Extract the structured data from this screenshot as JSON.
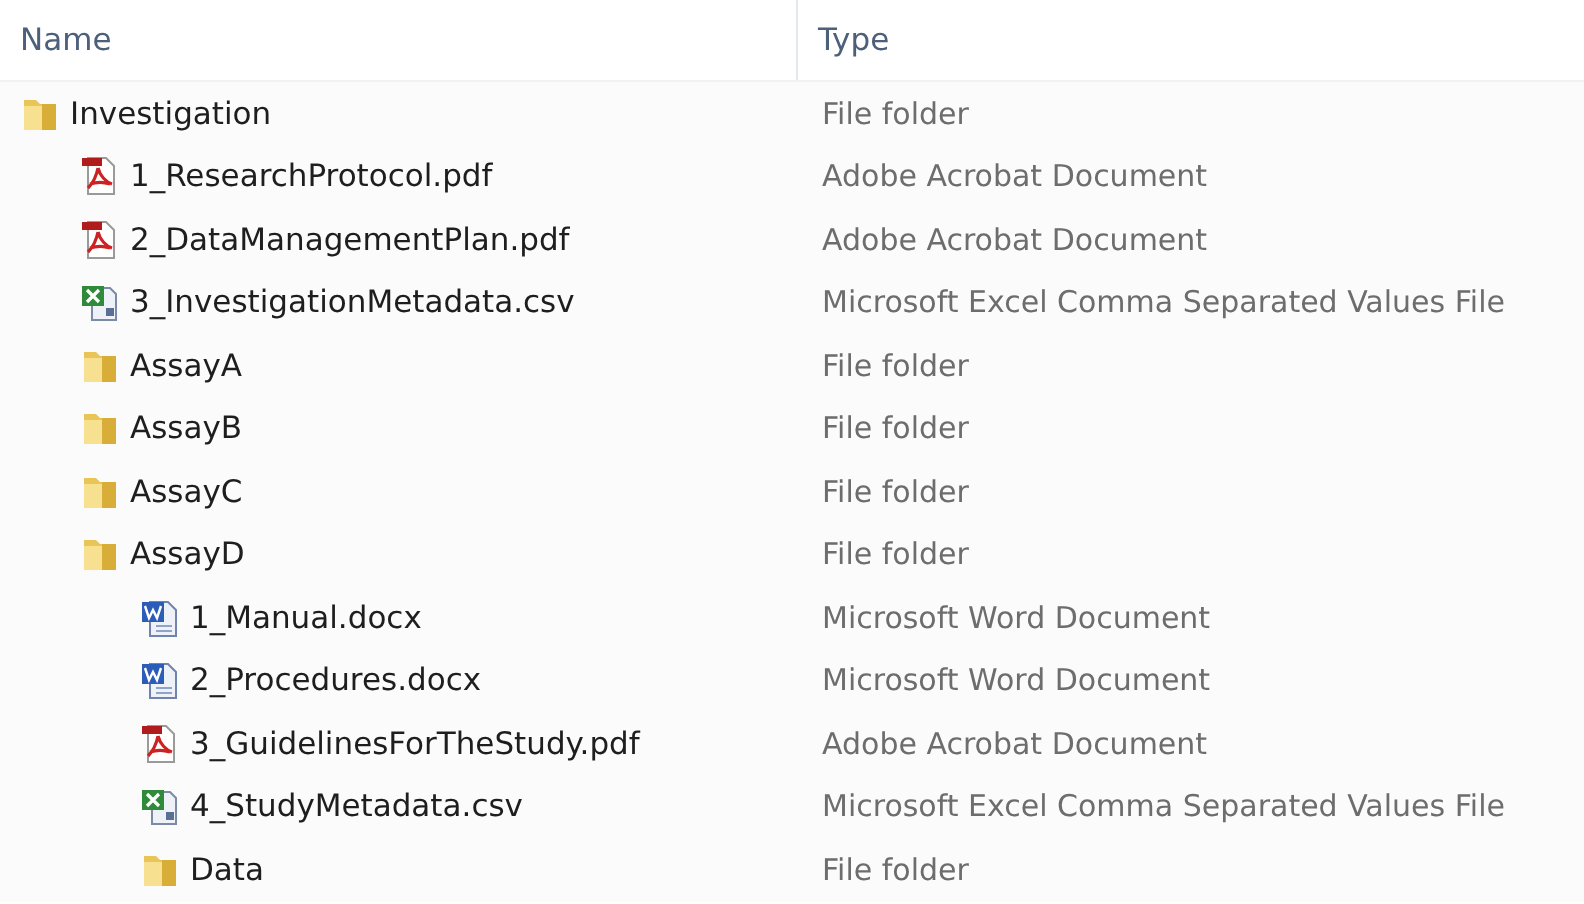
{
  "columns": [
    "Name",
    "Type"
  ],
  "items": [
    {
      "name": "Investigation",
      "kind": "folder",
      "type": "File folder",
      "children": [
        {
          "name": "1_ResearchProtocol.pdf",
          "kind": "pdf",
          "type": "Adobe Acrobat Document"
        },
        {
          "name": "2_DataManagementPlan.pdf",
          "kind": "pdf",
          "type": "Adobe Acrobat Document"
        },
        {
          "name": "3_InvestigationMetadata.csv",
          "kind": "excel",
          "type": "Microsoft Excel Comma Separated Values File"
        },
        {
          "name": "AssayA",
          "kind": "folder",
          "type": "File folder"
        },
        {
          "name": "AssayB",
          "kind": "folder",
          "type": "File folder"
        },
        {
          "name": "AssayC",
          "kind": "folder",
          "type": "File folder"
        },
        {
          "name": "AssayD",
          "kind": "folder",
          "type": "File folder",
          "children": [
            {
              "name": "1_Manual.docx",
              "kind": "word",
              "type": "Microsoft Word Document"
            },
            {
              "name": "2_Procedures.docx",
              "kind": "word",
              "type": "Microsoft Word Document"
            },
            {
              "name": "3_GuidelinesForTheStudy.pdf",
              "kind": "pdf",
              "type": "Adobe Acrobat Document"
            },
            {
              "name": "4_StudyMetadata.csv",
              "kind": "excel",
              "type": "Microsoft Excel Comma Separated Values File"
            },
            {
              "name": "Data",
              "kind": "folder",
              "type": "File folder"
            }
          ]
        }
      ]
    }
  ]
}
